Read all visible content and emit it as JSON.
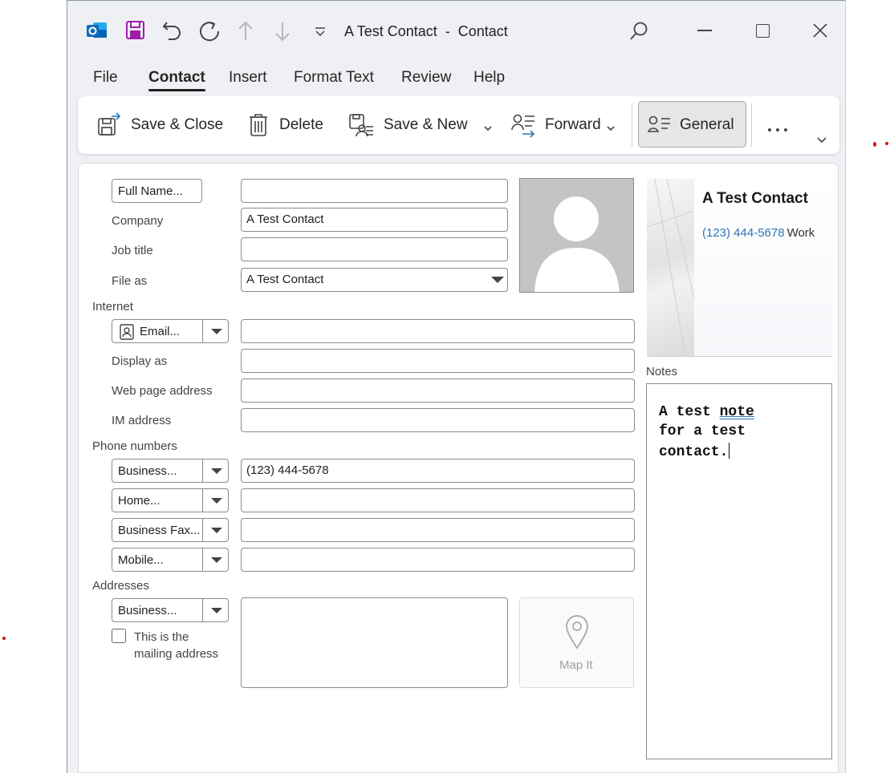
{
  "window": {
    "title": "A Test Contact  -  Contact",
    "icons": [
      "outlook-icon",
      "save-icon",
      "undo-icon",
      "redo-icon",
      "previous-item-icon",
      "next-item-icon",
      "customize-toolbar-icon",
      "search-icon",
      "minimize-icon",
      "maximize-icon",
      "close-icon"
    ]
  },
  "menu": {
    "file": "File",
    "contact": "Contact",
    "insert": "Insert",
    "format_text": "Format Text",
    "review": "Review",
    "help": "Help"
  },
  "ribbon": {
    "save_close": "Save & Close",
    "delete": "Delete",
    "save_new": "Save & New",
    "forward": "Forward",
    "general": "General",
    "more": "..."
  },
  "form": {
    "full_name_btn": "Full Name...",
    "full_name_value": "",
    "company_label": "Company",
    "company_value": "A Test Contact",
    "job_title_label": "Job title",
    "job_title_value": "",
    "file_as_label": "File as",
    "file_as_value": "A Test Contact",
    "internet_section": "Internet",
    "email_btn": "Email...",
    "email_value": "",
    "display_as_label": "Display as",
    "display_as_value": "",
    "web_page_label": "Web page address",
    "web_page_value": "",
    "im_label": "IM address",
    "im_value": "",
    "phone_section": "Phone numbers",
    "phones": [
      {
        "type": "Business...",
        "value": "(123) 444-5678"
      },
      {
        "type": "Home...",
        "value": ""
      },
      {
        "type": "Business Fax...",
        "value": ""
      },
      {
        "type": "Mobile...",
        "value": ""
      }
    ],
    "addresses_section": "Addresses",
    "address_type": "Business...",
    "address_value": "",
    "mailing_checkbox_line1": "This is the",
    "mailing_checkbox_line2": "mailing address",
    "mailing_checked": false,
    "map_it": "Map It"
  },
  "card": {
    "name": "A Test Contact",
    "phone": "(123) 444-5678",
    "phone_type": "Work"
  },
  "notes": {
    "label": "Notes",
    "line1": "A test ",
    "line1_underlined": "note",
    "line2": "for a test",
    "line3": "contact."
  },
  "colors": {
    "accent_blue": "#2e75b6",
    "save_purple": "#a01cad",
    "outlook_blue": "#0f6cbd"
  }
}
